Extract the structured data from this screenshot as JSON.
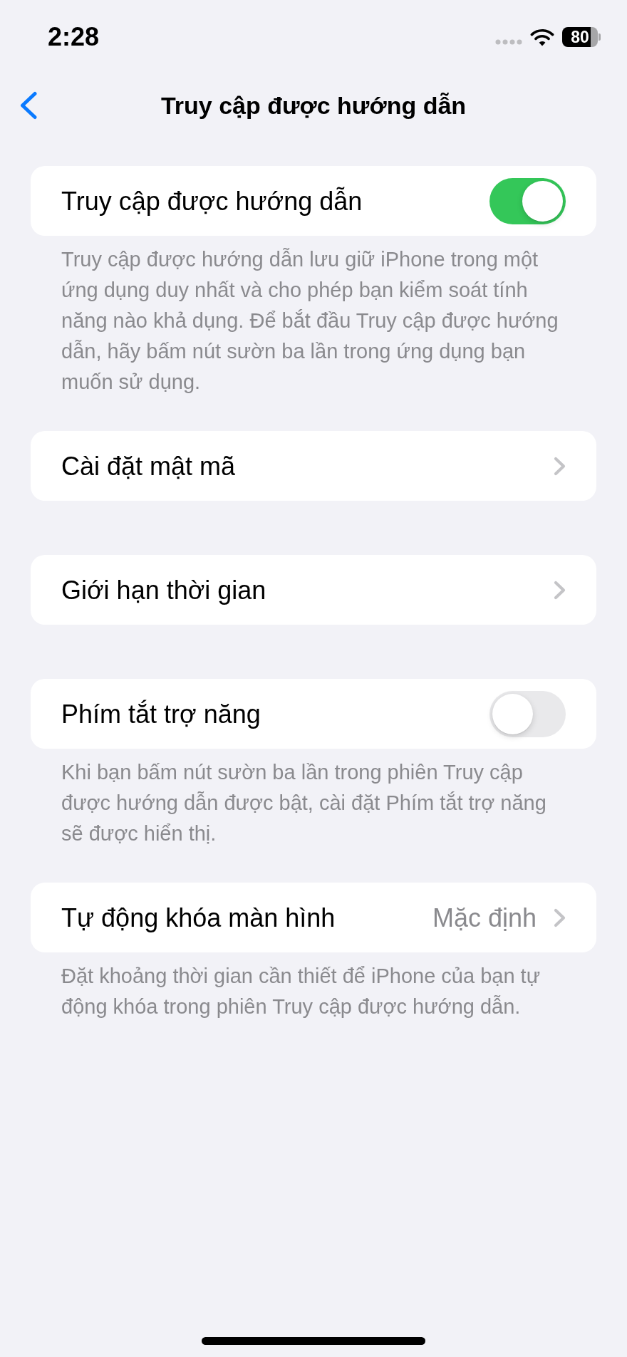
{
  "status_bar": {
    "time": "2:28",
    "battery": "80"
  },
  "nav_bar": {
    "title": "Truy cập được hướng dẫn"
  },
  "sections": [
    {
      "rows": [
        {
          "kind": "toggle",
          "label": "Truy cập được hướng dẫn",
          "on": true
        }
      ],
      "footer": "Truy cập được hướng dẫn lưu giữ iPhone trong một ứng dụng duy nhất và cho phép bạn kiểm soát tính năng nào khả dụng. Để bắt đầu Truy cập được hướng dẫn, hãy bấm nút sườn ba lần trong ứng dụng bạn muốn sử dụng."
    },
    {
      "rows": [
        {
          "kind": "link",
          "label": "Cài đặt mật mã"
        }
      ]
    },
    {
      "rows": [
        {
          "kind": "link",
          "label": "Giới hạn thời gian"
        }
      ]
    },
    {
      "rows": [
        {
          "kind": "toggle",
          "label": "Phím tắt trợ năng",
          "on": false
        }
      ],
      "footer": "Khi bạn bấm nút sườn ba lần trong phiên Truy cập được hướng dẫn được bật, cài đặt Phím tắt trợ năng sẽ được hiển thị."
    },
    {
      "rows": [
        {
          "kind": "link",
          "label": "Tự động khóa màn hình",
          "value": "Mặc định"
        }
      ],
      "footer": "Đặt khoảng thời gian cần thiết để iPhone của bạn tự động khóa trong phiên Truy cập được hướng dẫn."
    }
  ]
}
